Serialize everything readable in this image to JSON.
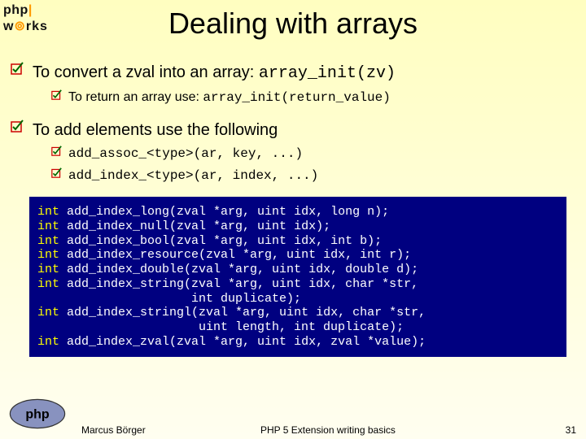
{
  "logo": {
    "line1a": "php",
    "pipe": "|",
    "line2a": "w",
    "line2b": "⊚",
    "line2c": "rks"
  },
  "title": "Dealing with arrays",
  "bullets": [
    {
      "pre": "To convert a zval into an array: ",
      "code": "array_init(zv)",
      "subs": [
        {
          "pre": "To return an array use: ",
          "code": "array_init(return_value)"
        }
      ]
    },
    {
      "pre": "To add elements use the following",
      "code": "",
      "subs": [
        {
          "pre": "",
          "code": "add_assoc_<type>(ar, key, ...)"
        },
        {
          "pre": "",
          "code": "add_index_<type>(ar, index, ...)"
        }
      ]
    }
  ],
  "code": [
    {
      "kw": "int",
      "rest": " add_index_long(zval *arg, uint idx, long n);"
    },
    {
      "kw": "int",
      "rest": " add_index_null(zval *arg, uint idx);"
    },
    {
      "kw": "int",
      "rest": " add_index_bool(zval *arg, uint idx, int b);"
    },
    {
      "kw": "int",
      "rest": " add_index_resource(zval *arg, uint idx, int r);"
    },
    {
      "kw": "int",
      "rest": " add_index_double(zval *arg, uint idx, double d);"
    },
    {
      "kw": "int",
      "rest": " add_index_string(zval *arg, uint idx, char *str,"
    },
    {
      "kw": "",
      "rest": "                     int duplicate);"
    },
    {
      "kw": "int",
      "rest": " add_index_stringl(zval *arg, uint idx, char *str,"
    },
    {
      "kw": "",
      "rest": "                      uint length, int duplicate);"
    },
    {
      "kw": "int",
      "rest": " add_index_zval(zval *arg, uint idx, zval *value);"
    }
  ],
  "footer": {
    "author": "Marcus Börger",
    "title": "PHP 5 Extension writing basics",
    "page": "31"
  }
}
